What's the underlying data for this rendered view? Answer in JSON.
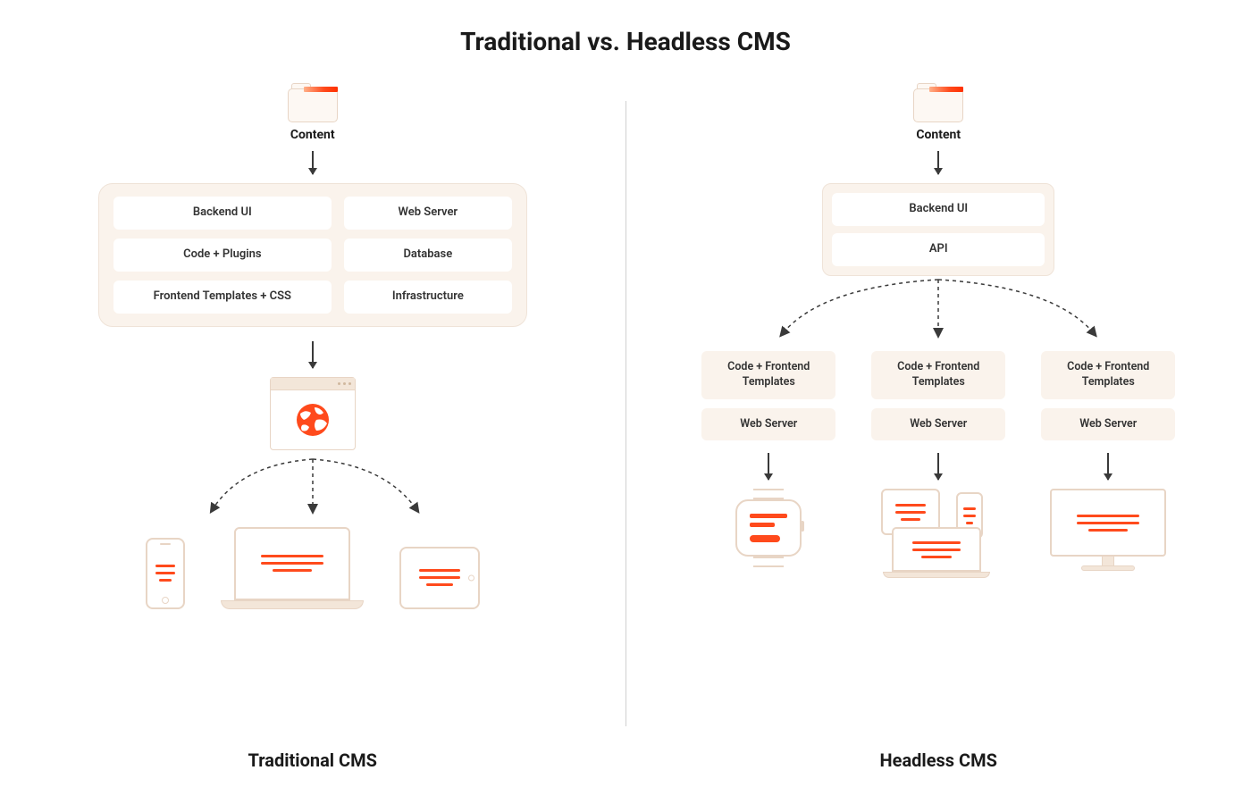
{
  "title": "Traditional vs. Headless CMS",
  "colors": {
    "accent": "#ff4a1c",
    "panel": "#faf3ec",
    "stroke": "#e8d5c5"
  },
  "traditional": {
    "label": "Traditional CMS",
    "content_label": "Content",
    "panel_left": [
      "Backend UI",
      "Code + Plugins",
      "Frontend Templates + CSS"
    ],
    "panel_right": [
      "Web Server",
      "Database",
      "Infrastructure"
    ],
    "devices": [
      "phone",
      "laptop",
      "tablet"
    ]
  },
  "headless": {
    "label": "Headless CMS",
    "content_label": "Content",
    "top_panel": [
      "Backend UI",
      "API"
    ],
    "columns": [
      {
        "top": "Code + Frontend Templates",
        "bottom": "Web Server",
        "device": "smartwatch"
      },
      {
        "top": "Code + Frontend Templates",
        "bottom": "Web Server",
        "device": "multi-device"
      },
      {
        "top": "Code + Frontend Templates",
        "bottom": "Web Server",
        "device": "desktop-monitor"
      }
    ]
  }
}
